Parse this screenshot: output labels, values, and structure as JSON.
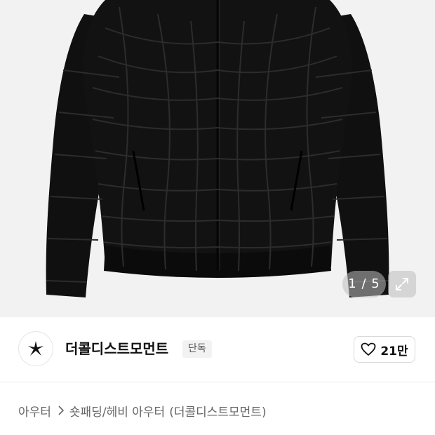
{
  "gallery": {
    "current": "1",
    "separator": "/",
    "total": "5",
    "counter_text": "1 / 5"
  },
  "brand": {
    "name": "더콜디스트모먼트",
    "badge": "단독",
    "likes": "21만"
  },
  "breadcrumb": {
    "category": "아우터",
    "subcategory": "숏패딩/헤비 아우터",
    "brand": "(더콜디스트모먼트)"
  },
  "icons": {
    "logo": "star-burst-logo",
    "expand": "expand-icon",
    "like": "heart-icon",
    "separator": "chevron-right-icon"
  },
  "colors": {
    "image_background": "#f2f2f2",
    "jacket": "#101010",
    "text_primary": "#111111",
    "text_secondary": "#666666",
    "badge_background": "#f2f2f2"
  }
}
